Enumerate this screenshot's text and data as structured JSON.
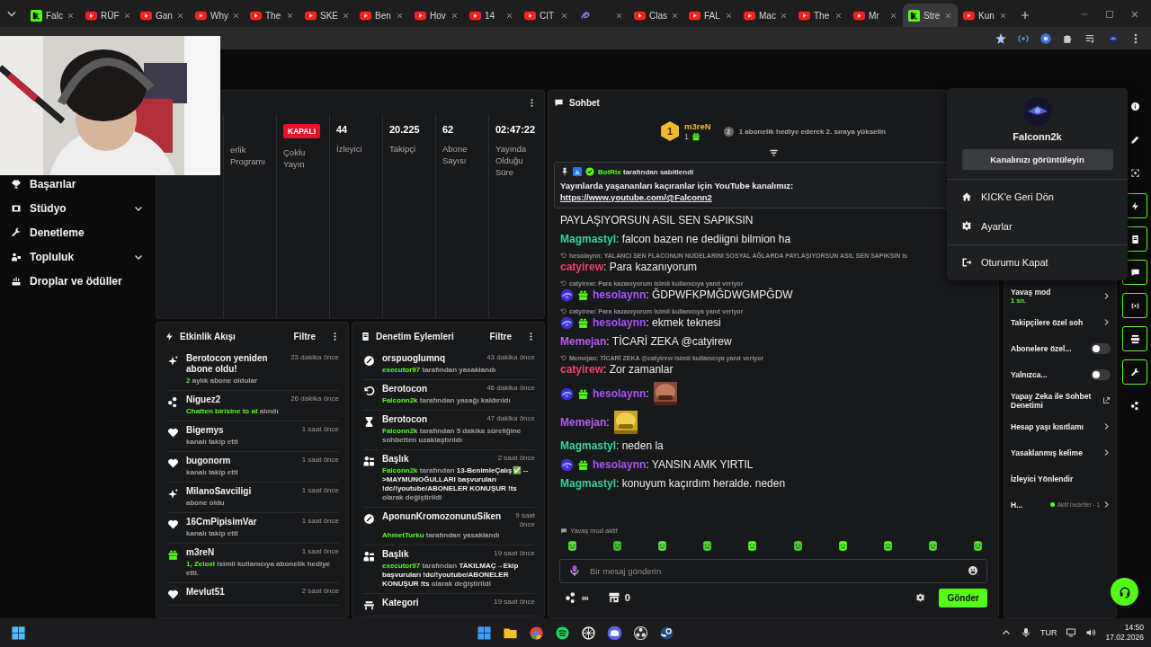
{
  "browser": {
    "tabs": [
      {
        "title": "Falc",
        "kind": "kick",
        "selected": false
      },
      {
        "title": "RÜF",
        "kind": "youtube",
        "selected": false
      },
      {
        "title": "Gan",
        "kind": "youtube",
        "selected": false
      },
      {
        "title": "Why",
        "kind": "youtube",
        "selected": false
      },
      {
        "title": "The",
        "kind": "youtube",
        "selected": false
      },
      {
        "title": "SKE",
        "kind": "youtube",
        "selected": false
      },
      {
        "title": "Ben",
        "kind": "youtube",
        "selected": false
      },
      {
        "title": "Hov",
        "kind": "youtube",
        "selected": false
      },
      {
        "title": "14",
        "kind": "youtube",
        "selected": false
      },
      {
        "title": "CIT",
        "kind": "youtube",
        "selected": false
      },
      {
        "kind": "other",
        "selected": false
      },
      {
        "title": "Clas",
        "kind": "youtube",
        "selected": false
      },
      {
        "title": "FAL",
        "kind": "youtube",
        "selected": false
      },
      {
        "title": "Mac",
        "kind": "youtube",
        "selected": false
      },
      {
        "title": "The",
        "kind": "youtube",
        "selected": false
      },
      {
        "title": "Mr",
        "kind": "youtube",
        "selected": false
      },
      {
        "title": "Stre",
        "kind": "kick",
        "selected": true
      },
      {
        "title": "Kun",
        "kind": "youtube",
        "selected": false
      }
    ]
  },
  "sidebar": {
    "items": [
      {
        "label": "Başarılar",
        "kind": "trophy",
        "expandable": false
      },
      {
        "label": "Stüdyo",
        "kind": "film",
        "expandable": true
      },
      {
        "label": "Denetleme",
        "kind": "wrench",
        "expandable": false
      },
      {
        "label": "Topluluk",
        "kind": "people",
        "expandable": true
      },
      {
        "label": "Droplar ve ödüller",
        "kind": "drops",
        "expandable": false
      }
    ]
  },
  "stats": [
    {
      "label": "erlik Programı"
    },
    {
      "badge": "KAPALI",
      "label": "Çoklu Yayın"
    },
    {
      "value": "44",
      "label": "İzleyici"
    },
    {
      "value": "20.225",
      "label": "Takipçi"
    },
    {
      "value": "62",
      "label": "Abone Sayısı"
    },
    {
      "value": "02:47:22",
      "label": "Yayında Olduğu Süre"
    }
  ],
  "activity_feed": {
    "title": "Etkinlik Akışı",
    "filter": "Filtre",
    "items": [
      {
        "kind": "sparkle",
        "name": "Berotocon yeniden abone oldu!",
        "time": "23 dakika önce",
        "detail": [
          {
            "text": "2",
            "kind": "green"
          },
          {
            "text": " aylık abone oldular",
            "kind": "grey"
          }
        ]
      },
      {
        "kind": "dots",
        "name": "Niguez2",
        "time": "26 dakika önce",
        "detail": [
          {
            "text": "Chatten birisine to at",
            "kind": "green"
          },
          {
            "text": " alındı",
            "kind": "grey"
          }
        ]
      },
      {
        "kind": "heart",
        "name": "Bigemys",
        "time": "1 saat önce",
        "detail": [
          {
            "text": "kanalı takip etti",
            "kind": "grey"
          }
        ]
      },
      {
        "kind": "heart",
        "name": "bugonorm",
        "time": "1 saat önce",
        "detail": [
          {
            "text": "kanalı takip etti",
            "kind": "grey"
          }
        ]
      },
      {
        "kind": "sparkle",
        "name": "MilanoSavciligi",
        "time": "1 saat önce",
        "detail": [
          {
            "text": "abone oldu",
            "kind": "grey"
          }
        ]
      },
      {
        "kind": "heart",
        "name": "16CmPipisimVar",
        "time": "1 saat önce",
        "detail": [
          {
            "text": "kanalı takip etti",
            "kind": "grey"
          }
        ]
      },
      {
        "kind": "gift",
        "name": "m3reN",
        "time": "1 saat önce",
        "detail": [
          {
            "text": "1, Zeloxl",
            "kind": "green"
          },
          {
            "text": " isimli kullanıcıya abonelik hediye etti.",
            "kind": "grey"
          }
        ]
      },
      {
        "kind": "heart",
        "name": "Mevlut51",
        "time": "2 saat önce"
      }
    ]
  },
  "moderation_log": {
    "title": "Denetim Eylemleri",
    "filter": "Filtre",
    "items": [
      {
        "kind": "ban",
        "name": "orspuoglumnq",
        "time": "43 dakika önce",
        "detail": [
          {
            "text": "executor97",
            "kind": "green"
          },
          {
            "text": " tarafından yasaklandı",
            "kind": "grey"
          }
        ]
      },
      {
        "kind": "undo",
        "name": "Berotocon",
        "time": "46 dakika önce",
        "detail": [
          {
            "text": "Falconn2k",
            "kind": "green"
          },
          {
            "text": " tarafından yasağı kaldırıldı",
            "kind": "grey"
          }
        ]
      },
      {
        "kind": "hourglass",
        "name": "Berotocon",
        "time": "47 dakika önce",
        "detail": [
          {
            "text": "Falconn2k",
            "kind": "green"
          },
          {
            "text": " tarafından 5 dakika süreliğine sohbetten uzaklaştırıldı",
            "kind": "grey"
          }
        ]
      },
      {
        "kind": "person-edit",
        "name": "Başlık",
        "time": "2 saat önce",
        "detail": [
          {
            "text": "Falconn2k",
            "kind": "green"
          },
          {
            "text": " tarafından ",
            "kind": "grey"
          },
          {
            "text": "13-BenimleÇalış✅ -->MAYMUNOĞULLARI başvuruları !dc/!youtube/ABONELER KONUŞUR !ts",
            "kind": "white"
          },
          {
            "text": " olarak değiştirildi",
            "kind": "grey"
          }
        ]
      },
      {
        "kind": "ban",
        "name": "AponunKromozonunuSiken",
        "time": "9 saat önce",
        "detail": [
          {
            "text": "AhmetTurku",
            "kind": "green"
          },
          {
            "text": " tarafından yasaklandı",
            "kind": "grey"
          }
        ]
      },
      {
        "kind": "person-edit",
        "name": "Başlık",
        "time": "19 saat önce",
        "detail": [
          {
            "text": "executor97",
            "kind": "green"
          },
          {
            "text": " tarafından ",
            "kind": "grey"
          },
          {
            "text": "TAKILMAÇ→Ekip başvuruları !dc/!youtube/ABONELER KONUŞUR !ts",
            "kind": "white"
          },
          {
            "text": " olarak değiştirildi",
            "kind": "grey"
          }
        ]
      },
      {
        "kind": "category",
        "name": "Kategori",
        "time": "19 saat önce"
      }
    ]
  },
  "chat": {
    "title": "Sohbet",
    "leader": {
      "rank": "1",
      "name": "m3reN",
      "count": "1"
    },
    "leader_hint": {
      "rank": "2",
      "text": "1 abonelik hediye ederek 2. sıraya yükselin"
    },
    "pinned": {
      "by": "BotRix",
      "by_suffix": " tarafından sabitlendi",
      "text": "Yayınlarda yaşananları kaçıranlar için YouTube kanalımız: ",
      "link": "https://www.youtube.com/@Falconn2"
    },
    "messages": [
      {
        "kind": "continuation",
        "text": "PAYLAŞIYORSUN ASIL SEN SAPIKSIN"
      },
      {
        "kind": "text",
        "user": "Magmastyl",
        "color": "#34d399",
        "badges": false,
        "text": ": falcon bazen ne dediigni bilmion ha"
      },
      {
        "kind": "text",
        "reply": "hesolaynn: YALANCI SEN FLACONUN NUDELARINI SOSYAL AĞLARDA PAYLAŞIYORSUN ASIL SEN SAPIKSIN is",
        "user": "catyirew",
        "color": "#e9456a",
        "badges": false,
        "text": ": Para kazanıyorum"
      },
      {
        "kind": "text",
        "reply": "catyirew: Para kazanıyorum isimli kullanıcıya yanıt veriyor",
        "user": "hesolaynn",
        "color": "#a855f7",
        "badges": true,
        "text": ": ĞDPWFKPMĞDWGMPĞDW"
      },
      {
        "kind": "text",
        "reply": "catyirew: Para kazanıyorum isimli kullanıcıya yanıt veriyor",
        "user": "hesolaynn",
        "color": "#a855f7",
        "badges": true,
        "text": ": ekmek teknesi"
      },
      {
        "kind": "text",
        "user": "Memejan",
        "color": "#b55cf0",
        "badges": false,
        "text": ": TİCARİ ZEKA @catyirew"
      },
      {
        "kind": "text",
        "reply": "Memejan: TİCARİ ZEKA @catyirew isimli kullanıcıya yanıt veriyor",
        "user": "catyirew",
        "color": "#e9456a",
        "badges": false,
        "text": ": Zor zamanlar"
      },
      {
        "kind": "emote",
        "user": "hesolaynn",
        "color": "#a855f7",
        "badges": true,
        "text": ":"
      },
      {
        "kind": "emote",
        "user": "Memejan",
        "color": "#b55cf0",
        "badges": false,
        "text": ":"
      },
      {
        "kind": "text",
        "user": "Magmastyl",
        "color": "#34d399",
        "badges": false,
        "text": ": neden la"
      },
      {
        "kind": "text",
        "user": "hesolaynn",
        "color": "#a855f7",
        "badges": true,
        "text": ": YANSIN AMK YIRTIL"
      },
      {
        "kind": "text",
        "user": "Magmastyl",
        "color": "#34d399",
        "badges": false,
        "text": ": konuyum kaçırdım heralde. neden"
      }
    ],
    "slow_mode_note": "Yavaş mod aktif",
    "input": {
      "placeholder": "Bir mesaj gönderin"
    },
    "points": "∞",
    "store_count": "0",
    "send": "Gönder"
  },
  "chat_settings": [
    {
      "kind": "arrow",
      "label": "Yavaş mod",
      "sub": "1 sn."
    },
    {
      "kind": "arrow",
      "label": "Takipçilere özel soh"
    },
    {
      "kind": "toggle",
      "label": "Abonelere özel...",
      "on": false
    },
    {
      "kind": "toggle",
      "label": "Yalnızca...",
      "on": false
    },
    {
      "kind": "external",
      "label": "Yapay Zeka ile Sohbet Denetimi"
    },
    {
      "kind": "arrow",
      "label": "Hesap yaşı kısıtlamı"
    },
    {
      "kind": "arrow",
      "label": "Yasaklanmış kelime"
    },
    {
      "kind": "plain",
      "label": "İzleyici Yönlendir"
    },
    {
      "kind": "goal",
      "label": "H...",
      "status": "Aktif hedefler - 1"
    }
  ],
  "side_tools": [
    {
      "kind": "info",
      "outlined": false
    },
    {
      "kind": "pencil",
      "outlined": false
    },
    {
      "kind": "scan",
      "outlined": false
    },
    {
      "kind": "bolt",
      "outlined": true
    },
    {
      "kind": "doc",
      "outlined": true
    },
    {
      "kind": "chat",
      "outlined": true
    },
    {
      "kind": "broadcast",
      "outlined": true
    },
    {
      "kind": "layout",
      "outlined": true
    },
    {
      "kind": "wrench",
      "outlined": true
    },
    {
      "kind": "dots",
      "outlined": false
    }
  ],
  "user_menu": {
    "user": "Falconn2k",
    "view_channel": "Kanalınızı görüntüleyin",
    "sections": [
      {
        "items": [
          {
            "label": "KICK'e Geri Dön",
            "kind": "home"
          },
          {
            "label": "Ayarlar",
            "kind": "gear"
          }
        ]
      },
      {
        "items": [
          {
            "label": "Oturumu Kapat",
            "kind": "logout"
          }
        ]
      }
    ]
  },
  "taskbar": {
    "language": "TUR",
    "time": "14:50",
    "date": "17.02.2026"
  }
}
